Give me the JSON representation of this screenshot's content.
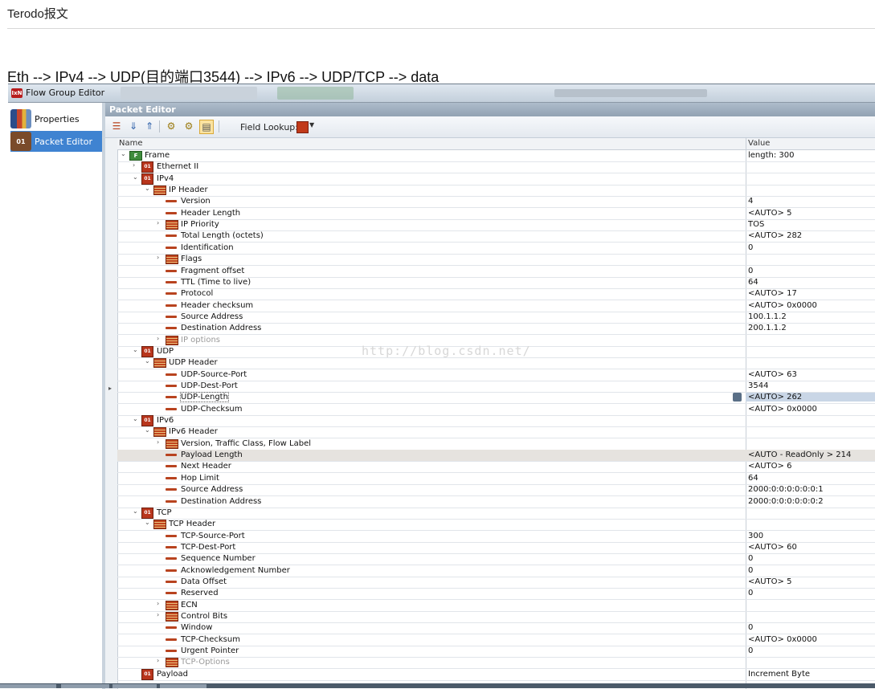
{
  "doc": {
    "title": "Terodo报文",
    "subtitle": "Eth --> IPv4 --> UDP(目的端口3544) --> IPv6 --> UDP/TCP --> data",
    "watermark": "http://blog.csdn.net/"
  },
  "window": {
    "title": "Flow Group Editor",
    "logo_text": "IxN"
  },
  "sidebar": {
    "items": [
      {
        "label": "Properties",
        "icon": "properties-icon",
        "selected": false
      },
      {
        "label": "Packet Editor",
        "icon": "packet-editor-icon",
        "icon_text": "01",
        "selected": true
      }
    ]
  },
  "packet_editor": {
    "header": "Packet Editor",
    "toolbar": {
      "field_lookup_label": "Field Lookup:",
      "buttons": [
        "add-layer-icon",
        "move-down-icon",
        "move-up-icon",
        "expand-all-icon",
        "collapse-all-icon",
        "view-toggle-icon"
      ]
    },
    "columns": {
      "name": "Name",
      "value": "Value"
    },
    "rows": [
      {
        "name": "Frame",
        "value": "length: 300",
        "level": 0,
        "kind": "frame",
        "expander": "minus"
      },
      {
        "name": "Ethernet II",
        "value": "",
        "level": 1,
        "kind": "protocol",
        "expander": "plus"
      },
      {
        "name": "IPv4",
        "value": "",
        "level": 1,
        "kind": "protocol",
        "expander": "minus"
      },
      {
        "name": "IP Header",
        "value": "",
        "level": 2,
        "kind": "header",
        "expander": "minus"
      },
      {
        "name": "Version",
        "value": "4",
        "level": 3,
        "kind": "field"
      },
      {
        "name": "Header Length",
        "value": "<AUTO> 5",
        "level": 3,
        "kind": "field"
      },
      {
        "name": "IP Priority",
        "value": "TOS",
        "level": 3,
        "kind": "header",
        "expander": "plus"
      },
      {
        "name": "Total Length (octets)",
        "value": "<AUTO> 282",
        "level": 3,
        "kind": "field"
      },
      {
        "name": "Identification",
        "value": "0",
        "level": 3,
        "kind": "field"
      },
      {
        "name": "Flags",
        "value": "",
        "level": 3,
        "kind": "header",
        "expander": "plus"
      },
      {
        "name": "Fragment offset",
        "value": "0",
        "level": 3,
        "kind": "field"
      },
      {
        "name": "TTL (Time to live)",
        "value": "64",
        "level": 3,
        "kind": "field"
      },
      {
        "name": "Protocol",
        "value": "<AUTO> 17",
        "level": 3,
        "kind": "field"
      },
      {
        "name": "Header checksum",
        "value": "<AUTO> 0x0000",
        "level": 3,
        "kind": "field"
      },
      {
        "name": "Source Address",
        "value": "100.1.1.2",
        "level": 3,
        "kind": "field"
      },
      {
        "name": "Destination Address",
        "value": "200.1.1.2",
        "level": 3,
        "kind": "field"
      },
      {
        "name": "IP options",
        "value": "",
        "level": 3,
        "kind": "header",
        "expander": "plus",
        "dim": true
      },
      {
        "name": "UDP",
        "value": "",
        "level": 1,
        "kind": "protocol",
        "expander": "minus"
      },
      {
        "name": "UDP Header",
        "value": "",
        "level": 2,
        "kind": "header",
        "expander": "minus"
      },
      {
        "name": "UDP-Source-Port",
        "value": "<AUTO> 63",
        "level": 3,
        "kind": "field"
      },
      {
        "name": "UDP-Dest-Port",
        "value": "3544",
        "level": 3,
        "kind": "field"
      },
      {
        "name": "UDP-Length",
        "value": "<AUTO> 262",
        "level": 3,
        "kind": "field",
        "selected": true
      },
      {
        "name": "UDP-Checksum",
        "value": "<AUTO> 0x0000",
        "level": 3,
        "kind": "field"
      },
      {
        "name": "IPv6",
        "value": "",
        "level": 1,
        "kind": "protocol",
        "expander": "minus"
      },
      {
        "name": "IPv6 Header",
        "value": "",
        "level": 2,
        "kind": "header",
        "expander": "minus"
      },
      {
        "name": "Version, Traffic Class, Flow Label",
        "value": "",
        "level": 3,
        "kind": "header",
        "expander": "plus"
      },
      {
        "name": "Payload Length",
        "value": "<AUTO - ReadOnly > 214",
        "level": 3,
        "kind": "field",
        "highlight": true
      },
      {
        "name": "Next Header",
        "value": "<AUTO> 6",
        "level": 3,
        "kind": "field"
      },
      {
        "name": "Hop Limit",
        "value": "64",
        "level": 3,
        "kind": "field"
      },
      {
        "name": "Source Address",
        "value": "2000:0:0:0:0:0:0:1",
        "level": 3,
        "kind": "field"
      },
      {
        "name": "Destination Address",
        "value": "2000:0:0:0:0:0:0:2",
        "level": 3,
        "kind": "field"
      },
      {
        "name": "TCP",
        "value": "",
        "level": 1,
        "kind": "protocol",
        "expander": "minus"
      },
      {
        "name": "TCP Header",
        "value": "",
        "level": 2,
        "kind": "header",
        "expander": "minus"
      },
      {
        "name": "TCP-Source-Port",
        "value": "300",
        "level": 3,
        "kind": "field"
      },
      {
        "name": "TCP-Dest-Port",
        "value": "<AUTO> 60",
        "level": 3,
        "kind": "field"
      },
      {
        "name": "Sequence Number",
        "value": "0",
        "level": 3,
        "kind": "field"
      },
      {
        "name": "Acknowledgement Number",
        "value": "0",
        "level": 3,
        "kind": "field"
      },
      {
        "name": "Data Offset",
        "value": "<AUTO> 5",
        "level": 3,
        "kind": "field"
      },
      {
        "name": "Reserved",
        "value": "0",
        "level": 3,
        "kind": "field"
      },
      {
        "name": "ECN",
        "value": "",
        "level": 3,
        "kind": "header",
        "expander": "plus"
      },
      {
        "name": "Control Bits",
        "value": "",
        "level": 3,
        "kind": "header",
        "expander": "plus"
      },
      {
        "name": "Window",
        "value": "0",
        "level": 3,
        "kind": "field"
      },
      {
        "name": "TCP-Checksum",
        "value": "<AUTO> 0x0000",
        "level": 3,
        "kind": "field"
      },
      {
        "name": "Urgent Pointer",
        "value": "0",
        "level": 3,
        "kind": "field"
      },
      {
        "name": "TCP-Options",
        "value": "",
        "level": 3,
        "kind": "header",
        "expander": "plus",
        "dim": true
      },
      {
        "name": "Payload",
        "value": "Increment Byte",
        "level": 1,
        "kind": "protocol"
      }
    ]
  },
  "colors": {
    "selected_nav": "#3f83d1",
    "header_bar": "#92a2b3",
    "protocol_icon": "#b8351c",
    "frame_icon": "#3f8c3c",
    "row_highlight": "#e6e3df",
    "row_selected": "#c9d6e6"
  }
}
